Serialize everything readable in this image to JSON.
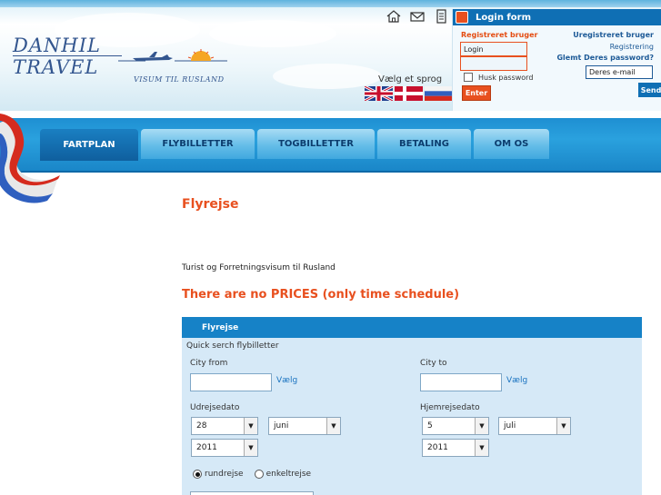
{
  "header": {
    "logo_line1": "DANHIL",
    "logo_line2": "TRAVEL",
    "tagline": "VISUM TIL RUSLAND",
    "icons": [
      "home-icon",
      "mail-icon",
      "document-icon"
    ],
    "language_label": "Vælg et sprog",
    "flags": [
      "uk-flag",
      "denmark-flag",
      "russia-flag"
    ]
  },
  "login": {
    "title": "Login form",
    "registered_title": "Registreret bruger",
    "login_value": "Login",
    "password_value": "",
    "remember_label": "Husk password",
    "enter_label": "Enter",
    "unregistered_title": "Uregistreret bruger",
    "register_link": "Registrering",
    "forgot_link": "Glemt Deres password?",
    "email_value": "Deres e-mail",
    "send_label": "Send"
  },
  "nav": {
    "tabs": [
      {
        "label": "FARTPLAN",
        "active": true
      },
      {
        "label": "FLYBILLETTER",
        "active": false
      },
      {
        "label": "TOGBILLETTER",
        "active": false
      },
      {
        "label": "BETALING",
        "active": false
      },
      {
        "label": "OM OS",
        "active": false
      }
    ]
  },
  "content": {
    "title": "Flyrejse",
    "intro": "Turist og Forretningsvisum til Rusland",
    "notice": "There are no PRICES (only time schedule)"
  },
  "search": {
    "panel_title": "Flyrejse",
    "quick_label": "Quick serch flybilletter",
    "city_from_label": "City from",
    "city_from_value": "",
    "city_to_label": "City to",
    "city_to_value": "",
    "choose_label": "Vælg",
    "departure_label": "Udrejsedato",
    "departure_day": "28",
    "departure_month": "juni",
    "departure_year": "2011",
    "return_label": "Hjemrejsedato",
    "return_day": "5",
    "return_month": "juli",
    "return_year": "2011",
    "round_trip_label": "rundrejse",
    "one_way_label": "enkeltrejse",
    "selected_trip": "rundrejse"
  },
  "colors": {
    "accent_orange": "#e8501f",
    "nav_blue": "#1e8fd2",
    "panel_blue": "#1682c7",
    "panel_bg": "#d6e9f7"
  }
}
